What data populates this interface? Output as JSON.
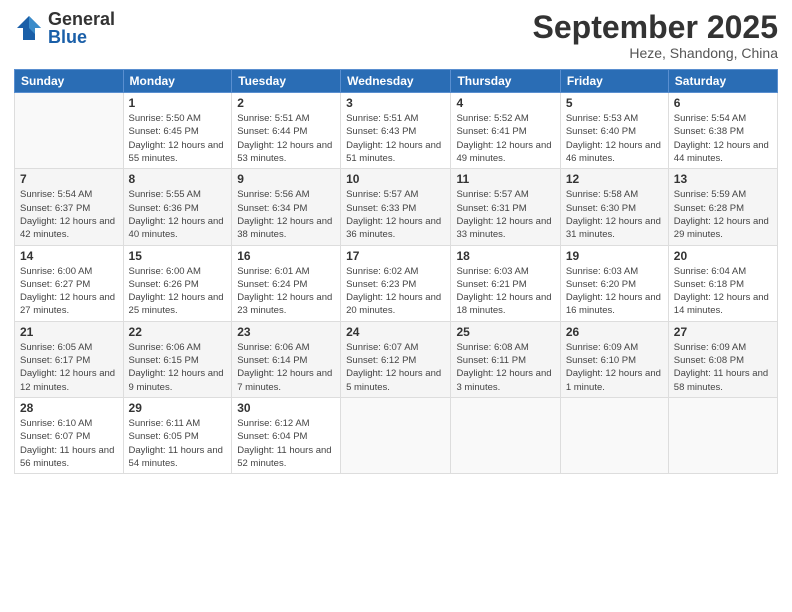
{
  "header": {
    "logo_general": "General",
    "logo_blue": "Blue",
    "month_title": "September 2025",
    "location": "Heze, Shandong, China"
  },
  "days_of_week": [
    "Sunday",
    "Monday",
    "Tuesday",
    "Wednesday",
    "Thursday",
    "Friday",
    "Saturday"
  ],
  "weeks": [
    [
      {
        "day": "",
        "info": ""
      },
      {
        "day": "1",
        "info": "Sunrise: 5:50 AM\nSunset: 6:45 PM\nDaylight: 12 hours\nand 55 minutes."
      },
      {
        "day": "2",
        "info": "Sunrise: 5:51 AM\nSunset: 6:44 PM\nDaylight: 12 hours\nand 53 minutes."
      },
      {
        "day": "3",
        "info": "Sunrise: 5:51 AM\nSunset: 6:43 PM\nDaylight: 12 hours\nand 51 minutes."
      },
      {
        "day": "4",
        "info": "Sunrise: 5:52 AM\nSunset: 6:41 PM\nDaylight: 12 hours\nand 49 minutes."
      },
      {
        "day": "5",
        "info": "Sunrise: 5:53 AM\nSunset: 6:40 PM\nDaylight: 12 hours\nand 46 minutes."
      },
      {
        "day": "6",
        "info": "Sunrise: 5:54 AM\nSunset: 6:38 PM\nDaylight: 12 hours\nand 44 minutes."
      }
    ],
    [
      {
        "day": "7",
        "info": "Sunrise: 5:54 AM\nSunset: 6:37 PM\nDaylight: 12 hours\nand 42 minutes."
      },
      {
        "day": "8",
        "info": "Sunrise: 5:55 AM\nSunset: 6:36 PM\nDaylight: 12 hours\nand 40 minutes."
      },
      {
        "day": "9",
        "info": "Sunrise: 5:56 AM\nSunset: 6:34 PM\nDaylight: 12 hours\nand 38 minutes."
      },
      {
        "day": "10",
        "info": "Sunrise: 5:57 AM\nSunset: 6:33 PM\nDaylight: 12 hours\nand 36 minutes."
      },
      {
        "day": "11",
        "info": "Sunrise: 5:57 AM\nSunset: 6:31 PM\nDaylight: 12 hours\nand 33 minutes."
      },
      {
        "day": "12",
        "info": "Sunrise: 5:58 AM\nSunset: 6:30 PM\nDaylight: 12 hours\nand 31 minutes."
      },
      {
        "day": "13",
        "info": "Sunrise: 5:59 AM\nSunset: 6:28 PM\nDaylight: 12 hours\nand 29 minutes."
      }
    ],
    [
      {
        "day": "14",
        "info": "Sunrise: 6:00 AM\nSunset: 6:27 PM\nDaylight: 12 hours\nand 27 minutes."
      },
      {
        "day": "15",
        "info": "Sunrise: 6:00 AM\nSunset: 6:26 PM\nDaylight: 12 hours\nand 25 minutes."
      },
      {
        "day": "16",
        "info": "Sunrise: 6:01 AM\nSunset: 6:24 PM\nDaylight: 12 hours\nand 23 minutes."
      },
      {
        "day": "17",
        "info": "Sunrise: 6:02 AM\nSunset: 6:23 PM\nDaylight: 12 hours\nand 20 minutes."
      },
      {
        "day": "18",
        "info": "Sunrise: 6:03 AM\nSunset: 6:21 PM\nDaylight: 12 hours\nand 18 minutes."
      },
      {
        "day": "19",
        "info": "Sunrise: 6:03 AM\nSunset: 6:20 PM\nDaylight: 12 hours\nand 16 minutes."
      },
      {
        "day": "20",
        "info": "Sunrise: 6:04 AM\nSunset: 6:18 PM\nDaylight: 12 hours\nand 14 minutes."
      }
    ],
    [
      {
        "day": "21",
        "info": "Sunrise: 6:05 AM\nSunset: 6:17 PM\nDaylight: 12 hours\nand 12 minutes."
      },
      {
        "day": "22",
        "info": "Sunrise: 6:06 AM\nSunset: 6:15 PM\nDaylight: 12 hours\nand 9 minutes."
      },
      {
        "day": "23",
        "info": "Sunrise: 6:06 AM\nSunset: 6:14 PM\nDaylight: 12 hours\nand 7 minutes."
      },
      {
        "day": "24",
        "info": "Sunrise: 6:07 AM\nSunset: 6:12 PM\nDaylight: 12 hours\nand 5 minutes."
      },
      {
        "day": "25",
        "info": "Sunrise: 6:08 AM\nSunset: 6:11 PM\nDaylight: 12 hours\nand 3 minutes."
      },
      {
        "day": "26",
        "info": "Sunrise: 6:09 AM\nSunset: 6:10 PM\nDaylight: 12 hours\nand 1 minute."
      },
      {
        "day": "27",
        "info": "Sunrise: 6:09 AM\nSunset: 6:08 PM\nDaylight: 11 hours\nand 58 minutes."
      }
    ],
    [
      {
        "day": "28",
        "info": "Sunrise: 6:10 AM\nSunset: 6:07 PM\nDaylight: 11 hours\nand 56 minutes."
      },
      {
        "day": "29",
        "info": "Sunrise: 6:11 AM\nSunset: 6:05 PM\nDaylight: 11 hours\nand 54 minutes."
      },
      {
        "day": "30",
        "info": "Sunrise: 6:12 AM\nSunset: 6:04 PM\nDaylight: 11 hours\nand 52 minutes."
      },
      {
        "day": "",
        "info": ""
      },
      {
        "day": "",
        "info": ""
      },
      {
        "day": "",
        "info": ""
      },
      {
        "day": "",
        "info": ""
      }
    ]
  ]
}
